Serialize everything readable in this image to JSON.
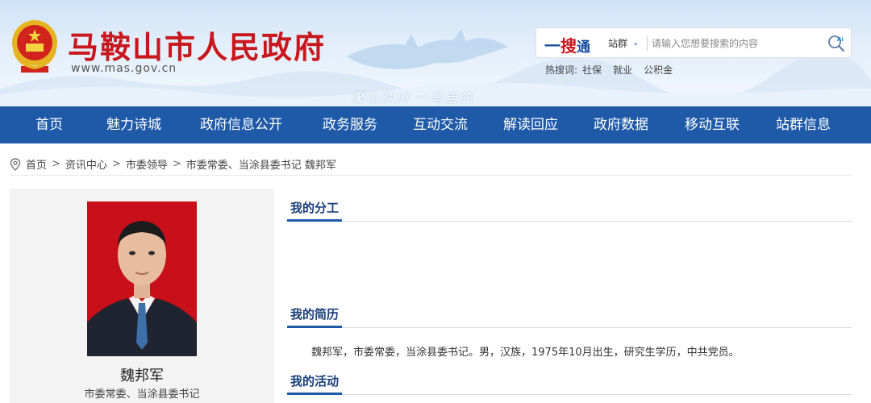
{
  "header": {
    "title": "马鞍山市人民政府",
    "url": "www.mas.gov.cn",
    "slogan": "聚山纳川  一马当先"
  },
  "search": {
    "brand_1": "一",
    "brand_2": "搜",
    "brand_3": "通",
    "scope": "站群",
    "placeholder": "请输入您想要搜索的内容",
    "hot_label": "热搜词:",
    "hot_words": [
      "社保",
      "就业",
      "公积金"
    ]
  },
  "nav": {
    "items": [
      "首页",
      "魅力诗城",
      "政府信息公开",
      "政务服务",
      "互动交流",
      "解读回应",
      "政府数据",
      "移动互联",
      "站群信息"
    ]
  },
  "breadcrumb": {
    "items": [
      "首页",
      "资讯中心",
      "市委领导",
      "市委常委、当涂县委书记 魏邦军"
    ],
    "separator": ">"
  },
  "profile": {
    "name": "魏邦军",
    "title": "市委常委、当涂县委书记"
  },
  "sections": {
    "duty": {
      "title": "我的分工"
    },
    "resume": {
      "title": "我的简历",
      "text": "魏邦军，市委常委，当涂县委书记。男，汉族，1975年10月出生，研究生学历，中共党员。"
    },
    "activity": {
      "title": "我的活动"
    }
  },
  "colors": {
    "brand_red": "#c9171e",
    "nav_blue": "#1f5aa8",
    "heading_blue": "#1b3f7a",
    "photo_bg": "#c8101b"
  },
  "icons": {
    "emblem": "national-emblem-icon",
    "search": "search-ai-icon",
    "location": "location-pin-icon",
    "scope_chevron": "chevron-down-icon"
  }
}
